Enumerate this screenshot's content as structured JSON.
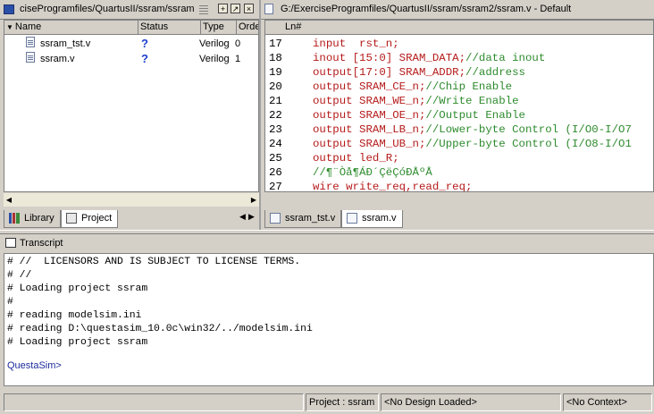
{
  "project_window": {
    "title": "ciseProgramfiles/QuartusII/ssram/ssram",
    "columns": [
      "Name",
      "Status",
      "Type",
      "Orde"
    ],
    "files": [
      {
        "name": "ssram_tst.v",
        "status": "?",
        "type": "Verilog",
        "order": "0"
      },
      {
        "name": "ssram.v",
        "status": "?",
        "type": "Verilog",
        "order": "1"
      }
    ],
    "tabs": [
      {
        "label": "Library",
        "active": false
      },
      {
        "label": "Project",
        "active": true
      }
    ]
  },
  "editor": {
    "title": "G:/ExerciseProgramfiles/QuartusII/ssram/ssram2/ssram.v - Default",
    "ln_header": "Ln#",
    "lines": [
      {
        "n": "17",
        "code": "input  rst_n;",
        "comment": ""
      },
      {
        "n": "18",
        "code": "inout [15:0] SRAM_DATA;",
        "comment": "//data inout"
      },
      {
        "n": "19",
        "code": "output[17:0] SRAM_ADDR;",
        "comment": "//address"
      },
      {
        "n": "20",
        "code": "output SRAM_CE_n;",
        "comment": "//Chip Enable"
      },
      {
        "n": "21",
        "code": "output SRAM_WE_n;",
        "comment": "//Write Enable"
      },
      {
        "n": "22",
        "code": "output SRAM_OE_n;",
        "comment": "//Output Enable"
      },
      {
        "n": "23",
        "code": "output SRAM_LB_n;",
        "comment": "//Lower-byte Control (I/O0-I/O7"
      },
      {
        "n": "24",
        "code": "output SRAM_UB_n;",
        "comment": "//Upper-byte Control (I/O8-I/O1"
      },
      {
        "n": "25",
        "code": "output led_R;",
        "comment": ""
      },
      {
        "n": "26",
        "code": "",
        "comment": "//¶¨Òå¶ÁÐ´ÇëÇóÐÅºÅ"
      },
      {
        "n": "27",
        "code": "wire write_req,read_req;",
        "comment": ""
      }
    ],
    "tabs": [
      {
        "label": "ssram_tst.v",
        "active": false
      },
      {
        "label": "ssram.v",
        "active": true
      }
    ]
  },
  "transcript": {
    "title": "Transcript",
    "lines": [
      "# //  LICENSORS AND IS SUBJECT TO LICENSE TERMS.",
      "# //",
      "# Loading project ssram",
      "#",
      "# reading modelsim.ini",
      "# reading D:\\questasim_10.0c\\win32/../modelsim.ini",
      "# Loading project ssram"
    ],
    "prompt": "QuestaSim>"
  },
  "statusbar": {
    "project": "Project : ssram",
    "design": "<No Design Loaded>",
    "context": "<No Context>"
  },
  "colors": {
    "keyword": "#b51a1a",
    "comment": "#2e8b2e",
    "prompt": "#1c2a9c",
    "status_icon": "#1c3fd0"
  }
}
